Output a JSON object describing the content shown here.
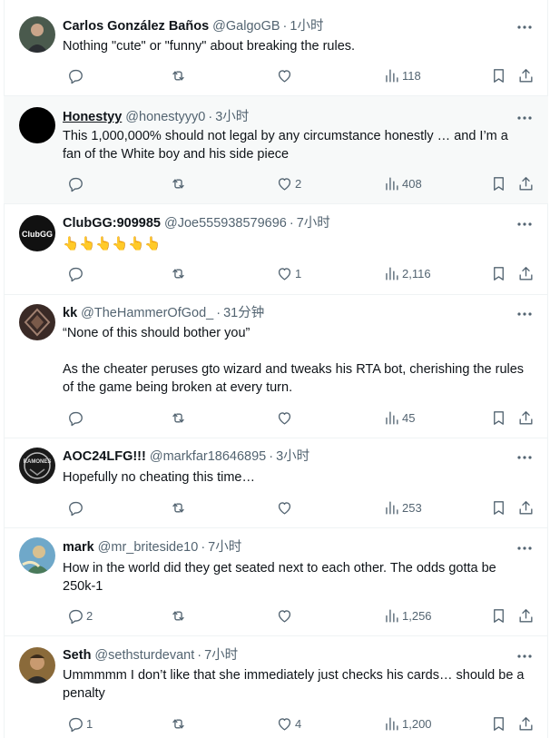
{
  "tweets": [
    {
      "name": "Carlos González Baños",
      "handle": "@GalgoGB",
      "sep": "·",
      "time": "1小时",
      "text": "Nothing \"cute\" or \"funny\" about breaking the rules.",
      "replies": "",
      "retweets": "",
      "likes": "",
      "views": "118"
    },
    {
      "name": "Honestyy",
      "handle": "@honestyyy0",
      "sep": "·",
      "time": "3小时",
      "text": "This 1,000,000% should not legal by any circumstance honestly … and I’m a fan of the White boy and his side piece",
      "replies": "",
      "retweets": "",
      "likes": "2",
      "views": "408"
    },
    {
      "name": "ClubGG:909985",
      "handle": "@Joe555938579696",
      "sep": "·",
      "time": "7小时",
      "text": "👆👆👆👆👆👆",
      "replies": "",
      "retweets": "",
      "likes": "1",
      "views": "2,116",
      "avatar_text": "ClubGG"
    },
    {
      "name": "kk",
      "handle": "@TheHammerOfGod_",
      "sep": "·",
      "time": "31分钟",
      "text": "“None of this should bother you”\n\nAs the cheater peruses gto wizard and tweaks his RTA bot, cherishing the rules of the game being broken at every turn.",
      "replies": "",
      "retweets": "",
      "likes": "",
      "views": "45"
    },
    {
      "name": "AOC24LFG!!!",
      "handle": "@markfar18646895",
      "sep": "·",
      "time": "3小时",
      "text": "Hopefully no cheating this time…",
      "replies": "",
      "retweets": "",
      "likes": "",
      "views": "253",
      "avatar_text": "RAMONES"
    },
    {
      "name": "mark",
      "handle": "@mr_briteside10",
      "sep": "·",
      "time": "7小时",
      "text": "How in the world did they get seated next to each other. The odds gotta be 250k-1",
      "replies": "2",
      "retweets": "",
      "likes": "",
      "views": "1,256"
    },
    {
      "name": "Seth",
      "handle": "@sethsturdevant",
      "sep": "·",
      "time": "7小时",
      "text": "Ummmmm I don’t like that she immediately just checks his cards… should be a penalty",
      "replies": "1",
      "retweets": "",
      "likes": "4",
      "views": "1,200"
    }
  ]
}
